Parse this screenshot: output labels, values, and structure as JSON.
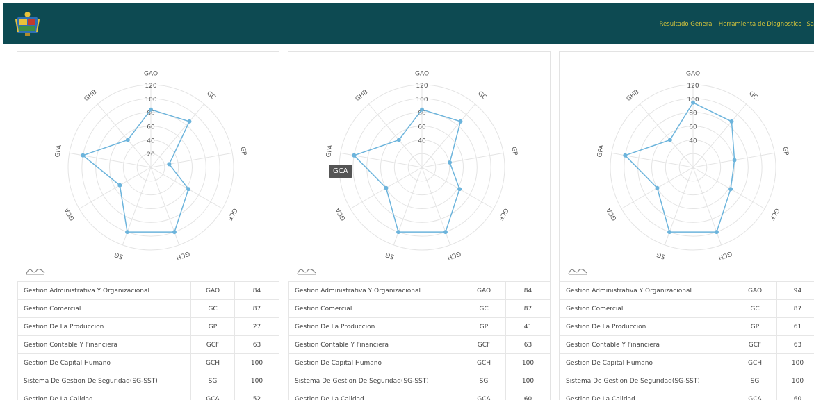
{
  "header": {
    "nav": [
      "Resultado General",
      "Herramienta de Diagnostico",
      "Sa"
    ]
  },
  "radar": {
    "ticks": [
      "120",
      "100",
      "80",
      "60",
      "40",
      "20"
    ],
    "axes": [
      "GAO",
      "GC",
      "GP",
      "GCF",
      "GCH",
      "SG",
      "GCA",
      "GPA",
      "GHB"
    ]
  },
  "cards": [
    {
      "values": [
        84,
        87,
        27,
        63,
        100,
        100,
        52,
        100,
        52
      ],
      "visible_ticks": [
        "120",
        "100",
        "80",
        "60",
        "40",
        "20"
      ],
      "rows": [
        {
          "name": "Gestion Administrativa Y Organizacional",
          "abbr": "GAO",
          "value": "84"
        },
        {
          "name": "Gestion Comercial",
          "abbr": "GC",
          "value": "87"
        },
        {
          "name": "Gestion De La Produccion",
          "abbr": "GP",
          "value": "27"
        },
        {
          "name": "Gestion Contable Y Financiera",
          "abbr": "GCF",
          "value": "63"
        },
        {
          "name": "Gestion De Capital Humano",
          "abbr": "GCH",
          "value": "100"
        },
        {
          "name": "Sistema De Gestion De Seguridad(SG-SST)",
          "abbr": "SG",
          "value": "100"
        },
        {
          "name": "Gestion De La Calidad",
          "abbr": "GCA",
          "value": "52"
        }
      ]
    },
    {
      "values": [
        84,
        87,
        41,
        63,
        100,
        100,
        60,
        100,
        52
      ],
      "visible_ticks": [
        "120",
        "100",
        "80",
        "60",
        "40"
      ],
      "tooltip": "GCA",
      "rows": [
        {
          "name": "Gestion Administrativa Y Organizacional",
          "abbr": "GAO",
          "value": "84"
        },
        {
          "name": "Gestion Comercial",
          "abbr": "GC",
          "value": "87"
        },
        {
          "name": "Gestion De La Produccion",
          "abbr": "GP",
          "value": "41"
        },
        {
          "name": "Gestion Contable Y Financiera",
          "abbr": "GCF",
          "value": "63"
        },
        {
          "name": "Gestion De Capital Humano",
          "abbr": "GCH",
          "value": "100"
        },
        {
          "name": "Sistema De Gestion De Seguridad(SG-SST)",
          "abbr": "SG",
          "value": "100"
        },
        {
          "name": "Gestion De La Calidad",
          "abbr": "GCA",
          "value": "60"
        }
      ]
    },
    {
      "values": [
        94,
        87,
        61,
        63,
        100,
        100,
        60,
        100,
        52
      ],
      "visible_ticks": [
        "120",
        "100",
        "80",
        "60",
        "40"
      ],
      "rows": [
        {
          "name": "Gestion Administrativa Y Organizacional",
          "abbr": "GAO",
          "value": "94"
        },
        {
          "name": "Gestion Comercial",
          "abbr": "GC",
          "value": "87"
        },
        {
          "name": "Gestion De La Produccion",
          "abbr": "GP",
          "value": "61"
        },
        {
          "name": "Gestion Contable Y Financiera",
          "abbr": "GCF",
          "value": "63"
        },
        {
          "name": "Gestion De Capital Humano",
          "abbr": "GCH",
          "value": "100"
        },
        {
          "name": "Sistema De Gestion De Seguridad(SG-SST)",
          "abbr": "SG",
          "value": "100"
        },
        {
          "name": "Gestion De La Calidad",
          "abbr": "GCA",
          "value": "60"
        }
      ]
    }
  ],
  "colors": {
    "header_bg": "#0d4a52",
    "nav_text": "#d4c43b",
    "series": "#6cb4dc",
    "grid": "#e4e4e4"
  },
  "icons": {
    "logo": "municipal-shield-logo",
    "chart_toggle": "area-chart-icon"
  }
}
